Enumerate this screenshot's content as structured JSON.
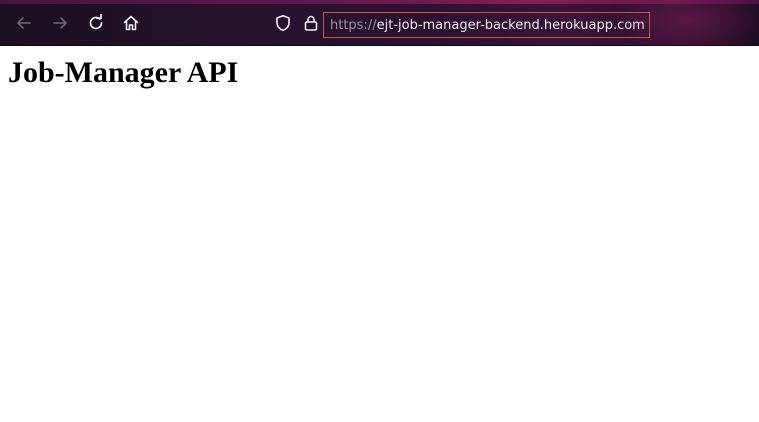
{
  "browser": {
    "url": {
      "scheme": "https://",
      "host": "ejt-job-manager-backend.herokuapp.com"
    },
    "toolbar_icons": [
      "back-icon",
      "forward-icon",
      "reload-icon",
      "home-icon",
      "shield-icon",
      "lock-icon"
    ],
    "colors": {
      "toolbar_bg": "#24122a",
      "url_border": "#d2533f",
      "icon_active": "#f0f0f4",
      "icon_disabled": "#6e6677"
    }
  },
  "page": {
    "title": "Job-Manager API"
  }
}
